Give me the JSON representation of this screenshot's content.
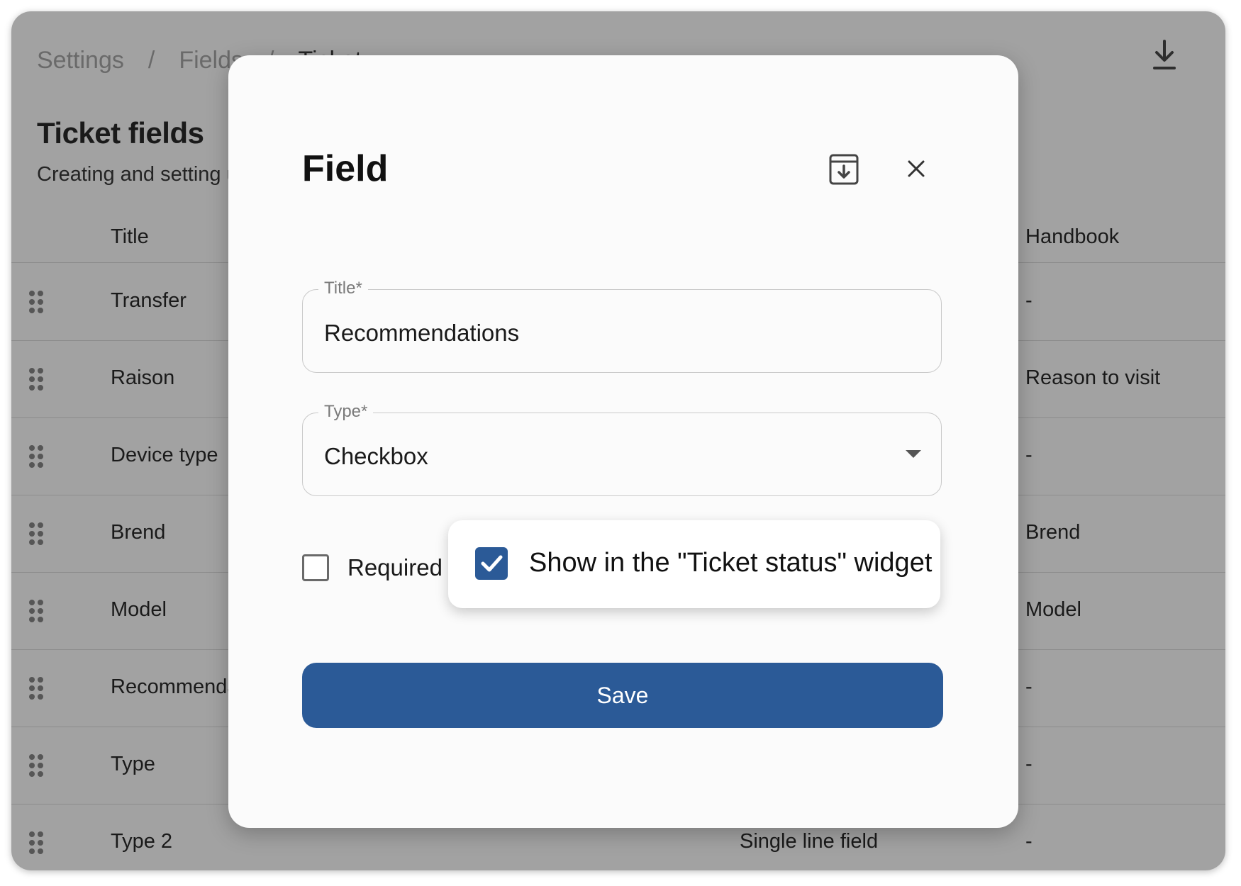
{
  "breadcrumb": {
    "items": [
      "Settings",
      "Fields",
      "Ticket"
    ],
    "separator": "/"
  },
  "page": {
    "title": "Ticket fields",
    "subtitle": "Creating and setting u",
    "columns": {
      "title": "Title",
      "type": "",
      "handbook": "Handbook"
    }
  },
  "table": {
    "rows": [
      {
        "title": "Transfer",
        "type": "",
        "handbook": "-"
      },
      {
        "title": "Raison",
        "type": "",
        "handbook": "Reason to visit"
      },
      {
        "title": "Device type",
        "type": "",
        "handbook": "-"
      },
      {
        "title": "Brend",
        "type": "",
        "handbook": "Brend"
      },
      {
        "title": "Model",
        "type": "",
        "handbook": "Model"
      },
      {
        "title": "Recommenda",
        "type": "",
        "handbook": "-"
      },
      {
        "title": "Type",
        "type": "",
        "handbook": "-"
      },
      {
        "title": "Type 2",
        "type": "Single line field",
        "handbook": "-"
      }
    ]
  },
  "modal": {
    "title": "Field",
    "title_field": {
      "label": "Title*",
      "value": "Recommendations"
    },
    "type_field": {
      "label": "Type*",
      "value": "Checkbox"
    },
    "required": {
      "label": "Required",
      "checked": false
    },
    "widget": {
      "label": "Show in the \"Ticket status\" widget",
      "checked": true
    },
    "save_label": "Save"
  },
  "colors": {
    "primary": "#2b5a97",
    "overlay": "rgba(40,40,40,0.42)",
    "border": "#c9c9c9"
  },
  "icons": [
    "export-download-icon",
    "drag-handle-icon",
    "archive-icon",
    "close-icon",
    "chevron-down-icon",
    "check-icon"
  ]
}
